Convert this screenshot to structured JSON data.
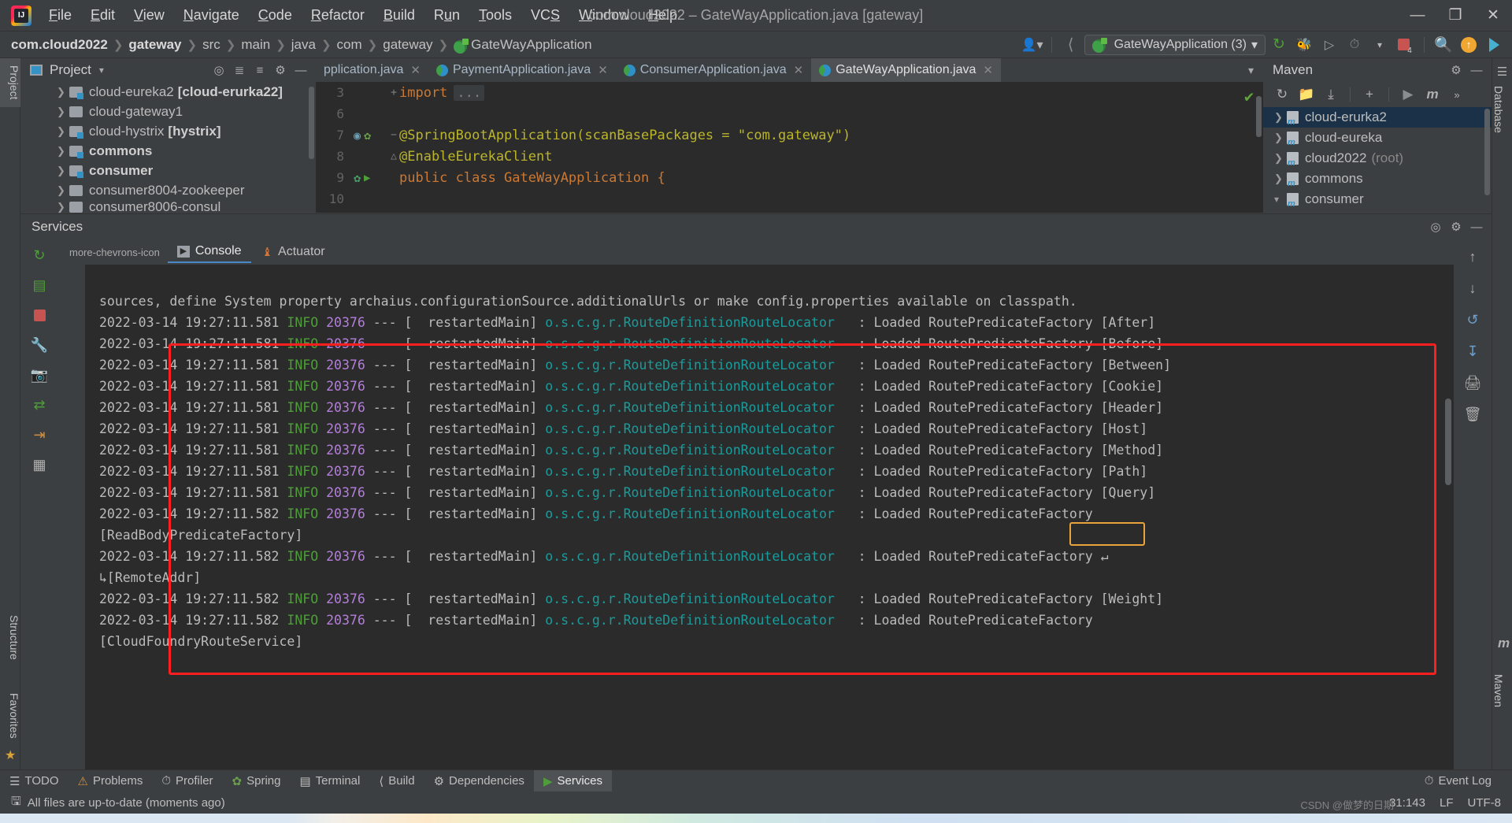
{
  "window": {
    "title": "com.cloud2022 – GateWayApplication.java [gateway]",
    "minimize": "—",
    "maximize": "❐",
    "close": "✕"
  },
  "menu": [
    "File",
    "Edit",
    "View",
    "Navigate",
    "Code",
    "Refactor",
    "Build",
    "Run",
    "Tools",
    "VCS",
    "Window",
    "Help"
  ],
  "breadcrumb": [
    {
      "label": "com.cloud2022",
      "bold": true
    },
    {
      "label": "gateway",
      "bold": true
    },
    {
      "label": "src",
      "bold": false
    },
    {
      "label": "main",
      "bold": false
    },
    {
      "label": "java",
      "bold": false
    },
    {
      "label": "com",
      "bold": false
    },
    {
      "label": "gateway",
      "bold": false
    },
    {
      "label": "GateWayApplication",
      "bold": false,
      "icon": "spring-class-icon"
    }
  ],
  "toolbar": {
    "run_configuration": "GateWayApplication (3)",
    "icons": [
      "user-avatar-icon",
      "hammer-build-icon",
      "rerun-icon",
      "debug-bug-icon",
      "run-coverage-icon",
      "profiler-icon",
      "dropdown-caret-icon",
      "stop-red-icon",
      "search-icon",
      "update-arrow-icon",
      "ide-feature-icon"
    ],
    "stop_badge": "4"
  },
  "left_strip": {
    "tabs": [
      "Project",
      "Structure",
      "Favorites"
    ],
    "active": "Project",
    "star_icon": "star-icon"
  },
  "right_strip": {
    "tabs": [
      "Database",
      "Maven"
    ]
  },
  "project_panel": {
    "title": "Project",
    "header_icons": [
      "locate-target-icon",
      "expand-all-icon",
      "collapse-all-icon",
      "settings-gear-icon",
      "hide-minus-icon"
    ],
    "items": [
      {
        "label": "cloud-eureka2",
        "suffix": "[cloud-erurka22]",
        "bold": false,
        "module": true
      },
      {
        "label": "cloud-gateway1",
        "suffix": "",
        "bold": false,
        "module": false
      },
      {
        "label": "cloud-hystrix",
        "suffix": "[hystrix]",
        "bold": false,
        "module": true
      },
      {
        "label": "commons",
        "suffix": "",
        "bold": true,
        "module": true
      },
      {
        "label": "consumer",
        "suffix": "",
        "bold": true,
        "module": true
      },
      {
        "label": "consumer8004-zookeeper",
        "suffix": "",
        "bold": false,
        "module": false
      },
      {
        "label": "consumer8006-consul",
        "suffix": "",
        "bold": false,
        "module": false
      }
    ]
  },
  "editor": {
    "tabs": [
      {
        "label": "pplication.java",
        "active": false,
        "icon": "java-class-icon",
        "close": "✕"
      },
      {
        "label": "PaymentApplication.java",
        "active": false,
        "icon": "spring-class-icon",
        "close": "✕"
      },
      {
        "label": "ConsumerApplication.java",
        "active": false,
        "icon": "spring-class-icon",
        "close": "✕"
      },
      {
        "label": "GateWayApplication.java",
        "active": true,
        "icon": "spring-class-icon",
        "close": "✕"
      }
    ],
    "tab_overflow_icon": "chevron-down-icon",
    "inspection_status": "✔",
    "lines": [
      {
        "num": "3",
        "fold": "+",
        "gutter_icons": [],
        "text": "import",
        "folded": "..."
      },
      {
        "num": "6",
        "fold": "",
        "gutter_icons": [],
        "text": ""
      },
      {
        "num": "7",
        "fold": "−",
        "gutter_icons": [
          "bean-icon",
          "spring-leaf-icon"
        ],
        "text": "@SpringBootApplication(scanBasePackages = \"com.gateway\")"
      },
      {
        "num": "8",
        "fold": "",
        "gutter_icons": [],
        "text": "@EnableEurekaClient"
      },
      {
        "num": "9",
        "fold": "",
        "gutter_icons": [
          "spring-bean-icon",
          "run-green-icon"
        ],
        "text": "public class GateWayApplication {"
      },
      {
        "num": "10",
        "fold": "",
        "gutter_icons": [],
        "text": ""
      }
    ]
  },
  "maven_panel": {
    "title": "Maven",
    "header_icons": [
      "settings-gear-icon",
      "hide-minus-icon"
    ],
    "toolbar_icons": [
      "reload-icon",
      "add-folder-icon",
      "download-sources-icon",
      "plus-icon",
      "run-icon",
      "maven-goal-icon",
      "more-chevrons-icon"
    ],
    "items": [
      {
        "label": "cloud-erurka2",
        "suffix": "",
        "selected": true
      },
      {
        "label": "cloud-eureka",
        "suffix": "",
        "selected": false
      },
      {
        "label": "cloud2022",
        "suffix": "(root)",
        "selected": false
      },
      {
        "label": "commons",
        "suffix": "",
        "selected": false
      },
      {
        "label": "consumer",
        "suffix": "",
        "selected": false
      }
    ]
  },
  "services": {
    "title": "Services",
    "header_icons": [
      "locate-target-icon",
      "settings-gear-icon",
      "hide-minus-icon"
    ],
    "left_icons": [
      "rerun-icon",
      "services-tree-icon",
      "stop-red-icon",
      "wrench-icon",
      "camera-icon",
      "thread-dump-icon",
      "exit-icon",
      "layout-icon"
    ],
    "right_icons": [
      "scroll-up-icon",
      "scroll-down-icon",
      "soft-wrap-icon",
      "scroll-to-end-icon",
      "print-icon",
      "trash-icon"
    ],
    "more_icon": "more-chevrons-icon",
    "tabs": [
      {
        "label": "Console",
        "active": true,
        "icon": "console-icon"
      },
      {
        "label": "Actuator",
        "active": false,
        "icon": "actuator-icon"
      }
    ],
    "console": {
      "preamble": "sources, define System property archaius.configurationSource.additionalUrls or make config.properties available on classpath.",
      "lines": [
        {
          "date": "2022-03-14 19:27:11.581",
          "level": "INFO",
          "pid": "20376",
          "sep": "--- [",
          "thread": "  restartedMain]",
          "logger": "o.s.c.g.r.RouteDefinitionRouteLocator",
          "msg": ": Loaded RoutePredicateFactory [After]"
        },
        {
          "date": "2022-03-14 19:27:11.581",
          "level": "INFO",
          "pid": "20376",
          "sep": "--- [",
          "thread": "  restartedMain]",
          "logger": "o.s.c.g.r.RouteDefinitionRouteLocator",
          "msg": ": Loaded RoutePredicateFactory [Before]"
        },
        {
          "date": "2022-03-14 19:27:11.581",
          "level": "INFO",
          "pid": "20376",
          "sep": "--- [",
          "thread": "  restartedMain]",
          "logger": "o.s.c.g.r.RouteDefinitionRouteLocator",
          "msg": ": Loaded RoutePredicateFactory [Between]"
        },
        {
          "date": "2022-03-14 19:27:11.581",
          "level": "INFO",
          "pid": "20376",
          "sep": "--- [",
          "thread": "  restartedMain]",
          "logger": "o.s.c.g.r.RouteDefinitionRouteLocator",
          "msg": ": Loaded RoutePredicateFactory [Cookie]"
        },
        {
          "date": "2022-03-14 19:27:11.581",
          "level": "INFO",
          "pid": "20376",
          "sep": "--- [",
          "thread": "  restartedMain]",
          "logger": "o.s.c.g.r.RouteDefinitionRouteLocator",
          "msg": ": Loaded RoutePredicateFactory [Header]"
        },
        {
          "date": "2022-03-14 19:27:11.581",
          "level": "INFO",
          "pid": "20376",
          "sep": "--- [",
          "thread": "  restartedMain]",
          "logger": "o.s.c.g.r.RouteDefinitionRouteLocator",
          "msg": ": Loaded RoutePredicateFactory [Host]"
        },
        {
          "date": "2022-03-14 19:27:11.581",
          "level": "INFO",
          "pid": "20376",
          "sep": "--- [",
          "thread": "  restartedMain]",
          "logger": "o.s.c.g.r.RouteDefinitionRouteLocator",
          "msg": ": Loaded RoutePredicateFactory [Method]"
        },
        {
          "date": "2022-03-14 19:27:11.581",
          "level": "INFO",
          "pid": "20376",
          "sep": "--- [",
          "thread": "  restartedMain]",
          "logger": "o.s.c.g.r.RouteDefinitionRouteLocator",
          "msg": ": Loaded RoutePredicateFactory [Path]",
          "highlighted": true
        },
        {
          "date": "2022-03-14 19:27:11.581",
          "level": "INFO",
          "pid": "20376",
          "sep": "--- [",
          "thread": "  restartedMain]",
          "logger": "o.s.c.g.r.RouteDefinitionRouteLocator",
          "msg": ": Loaded RoutePredicateFactory [Query]"
        },
        {
          "date": "2022-03-14 19:27:11.582",
          "level": "INFO",
          "pid": "20376",
          "sep": "--- [",
          "thread": "  restartedMain]",
          "logger": "o.s.c.g.r.RouteDefinitionRouteLocator",
          "msg": ": Loaded RoutePredicateFactory"
        },
        {
          "wrap": "[ReadBodyPredicateFactory]"
        },
        {
          "date": "2022-03-14 19:27:11.582",
          "level": "INFO",
          "pid": "20376",
          "sep": "--- [",
          "thread": "  restartedMain]",
          "logger": "o.s.c.g.r.RouteDefinitionRouteLocator",
          "msg": ": Loaded RoutePredicateFactory ↵"
        },
        {
          "wrap": "↳[RemoteAddr]"
        },
        {
          "date": "2022-03-14 19:27:11.582",
          "level": "INFO",
          "pid": "20376",
          "sep": "--- [",
          "thread": "  restartedMain]",
          "logger": "o.s.c.g.r.RouteDefinitionRouteLocator",
          "msg": ": Loaded RoutePredicateFactory [Weight]"
        },
        {
          "date": "2022-03-14 19:27:11.582",
          "level": "INFO",
          "pid": "20376",
          "sep": "--- [",
          "thread": "  restartedMain]",
          "logger": "o.s.c.g.r.RouteDefinitionRouteLocator",
          "msg": ": Loaded RoutePredicateFactory"
        },
        {
          "wrap": "[CloudFoundryRouteService]"
        }
      ]
    }
  },
  "bottom_tabs": [
    {
      "label": "TODO",
      "icon": "todo-icon",
      "active": false
    },
    {
      "label": "Problems",
      "icon": "problems-icon",
      "active": false
    },
    {
      "label": "Profiler",
      "icon": "profiler-icon",
      "active": false
    },
    {
      "label": "Spring",
      "icon": "spring-leaf-icon",
      "active": false
    },
    {
      "label": "Terminal",
      "icon": "terminal-icon",
      "active": false
    },
    {
      "label": "Build",
      "icon": "build-hammer-icon",
      "active": false
    },
    {
      "label": "Dependencies",
      "icon": "dependencies-icon",
      "active": false
    },
    {
      "label": "Services",
      "icon": "services-icon",
      "active": true
    }
  ],
  "event_log": {
    "label": "Event Log",
    "icon": "event-log-icon"
  },
  "status_bar": {
    "message": "All files are up-to-date (moments ago)",
    "icon": "save-status-icon",
    "caret": "31:143",
    "line_separator": "LF",
    "encoding": "UTF-8",
    "watermark": "CSDN @做梦的日期"
  },
  "colors": {
    "accent_blue": "#3592c4",
    "selection_blue": "#1b3147",
    "red_box": "#ff1f1f",
    "orange_box": "#e8a33d",
    "console_bg": "#2b2b2b",
    "panel_bg": "#3c3f41",
    "logger_teal": "#1a9c9c",
    "info_green": "#4f9d3a",
    "pid_purple": "#b57edc"
  }
}
